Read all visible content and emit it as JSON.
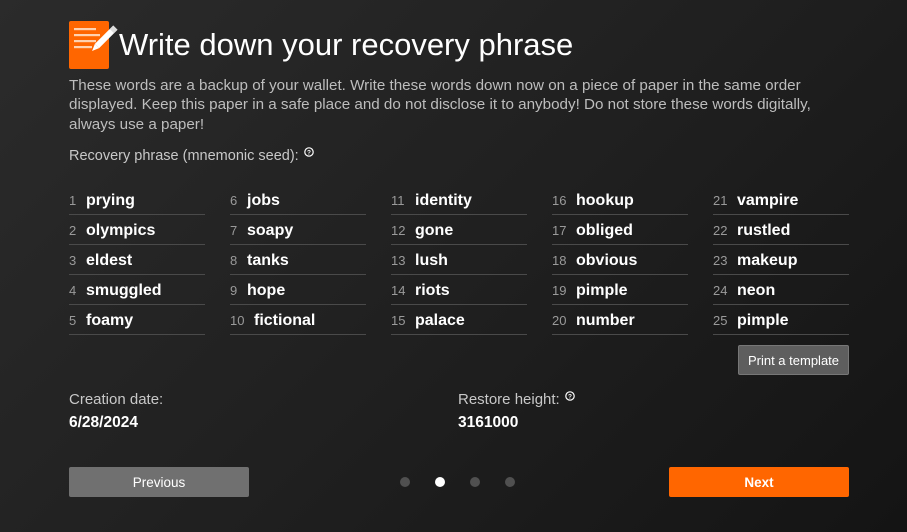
{
  "header": {
    "title": "Write down your recovery phrase",
    "icon": "notepad-pencil-icon",
    "accent_color": "#ff6600"
  },
  "description": "These words are a backup of your wallet. Write these words down now on a piece of paper in the same order displayed. Keep this paper in a safe place and do not disclose it to anybody! Do not store these words digitally, always use a paper!",
  "recovery_phrase": {
    "label": "Recovery phrase (mnemonic seed):",
    "help_icon": "question-circle-icon",
    "words": [
      {
        "num": "1",
        "word": "prying"
      },
      {
        "num": "2",
        "word": "olympics"
      },
      {
        "num": "3",
        "word": "eldest"
      },
      {
        "num": "4",
        "word": "smuggled"
      },
      {
        "num": "5",
        "word": "foamy"
      },
      {
        "num": "6",
        "word": "jobs"
      },
      {
        "num": "7",
        "word": "soapy"
      },
      {
        "num": "8",
        "word": "tanks"
      },
      {
        "num": "9",
        "word": "hope"
      },
      {
        "num": "10",
        "word": "fictional"
      },
      {
        "num": "11",
        "word": "identity"
      },
      {
        "num": "12",
        "word": "gone"
      },
      {
        "num": "13",
        "word": "lush"
      },
      {
        "num": "14",
        "word": "riots"
      },
      {
        "num": "15",
        "word": "palace"
      },
      {
        "num": "16",
        "word": "hookup"
      },
      {
        "num": "17",
        "word": "obliged"
      },
      {
        "num": "18",
        "word": "obvious"
      },
      {
        "num": "19",
        "word": "pimple"
      },
      {
        "num": "20",
        "word": "number"
      },
      {
        "num": "21",
        "word": "vampire"
      },
      {
        "num": "22",
        "word": "rustled"
      },
      {
        "num": "23",
        "word": "makeup"
      },
      {
        "num": "24",
        "word": "neon"
      },
      {
        "num": "25",
        "word": "pimple"
      }
    ]
  },
  "print_button": "Print a template",
  "creation_date": {
    "label": "Creation date:",
    "value": "6/28/2024"
  },
  "restore_height": {
    "label": "Restore height:",
    "value": "3161000",
    "help_icon": "question-circle-icon"
  },
  "navigation": {
    "previous_label": "Previous",
    "next_label": "Next",
    "pages": 4,
    "active_page": 2
  }
}
